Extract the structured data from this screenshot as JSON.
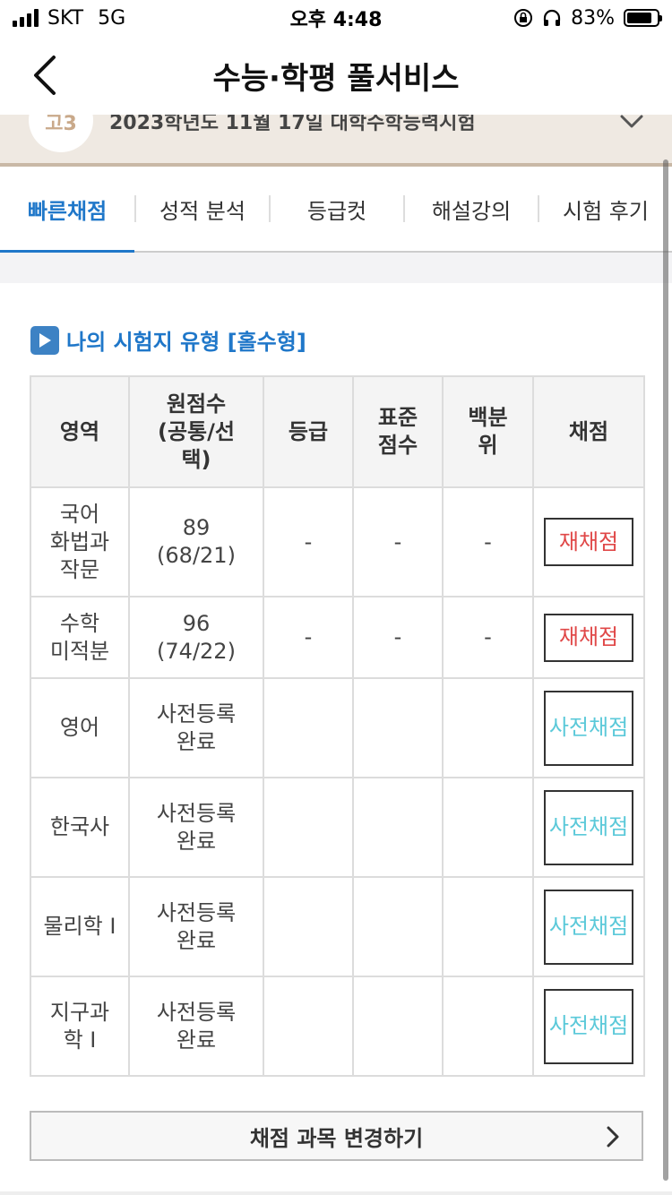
{
  "status_bar": {
    "carrier": "SKT",
    "network": "5G",
    "time": "오후 4:48",
    "battery_percent": "83%",
    "battery_level": 0.83
  },
  "nav": {
    "title": "수능·학평 풀서비스",
    "back_icon": "chevron-left-icon"
  },
  "exam": {
    "grade": "고3",
    "title": "2023학년도 11월 17일 대학수학능력시험"
  },
  "tabs": [
    {
      "label": "빠른채점",
      "active": true
    },
    {
      "label": "성적 분석",
      "active": false
    },
    {
      "label": "등급컷",
      "active": false
    },
    {
      "label": "해설강의",
      "active": false
    },
    {
      "label": "시험 후기",
      "active": false
    }
  ],
  "section": {
    "title": "나의 시험지 유형 [홀수형]"
  },
  "table": {
    "headers": {
      "area": "영역",
      "raw_line1": "원점수",
      "raw_line2": "(공통/선",
      "raw_line3": "택)",
      "grade": "등급",
      "std_line1": "표준",
      "std_line2": "점수",
      "pct_line1": "백분",
      "pct_line2": "위",
      "score": "채점"
    },
    "rows": [
      {
        "area1": "국어",
        "area2": "화법과",
        "area3": "작문",
        "raw1": "89",
        "raw2": "(68/21)",
        "grade": "-",
        "std": "-",
        "pct": "-",
        "btn1": "재채점",
        "btn2": ""
      },
      {
        "area1": "수학",
        "area2": "미적분",
        "area3": "",
        "raw1": "96",
        "raw2": "(74/22)",
        "grade": "-",
        "std": "-",
        "pct": "-",
        "btn1": "재채점",
        "btn2": ""
      },
      {
        "area1": "영어",
        "area2": "",
        "area3": "",
        "raw1": "사전등록",
        "raw2": "완료",
        "grade": "",
        "std": "",
        "pct": "",
        "btn1": "사전",
        "btn2": "채점"
      },
      {
        "area1": "한국사",
        "area2": "",
        "area3": "",
        "raw1": "사전등록",
        "raw2": "완료",
        "grade": "",
        "std": "",
        "pct": "",
        "btn1": "사전",
        "btn2": "채점"
      },
      {
        "area1": "물리학 I",
        "area2": "",
        "area3": "",
        "raw1": "사전등록",
        "raw2": "완료",
        "grade": "",
        "std": "",
        "pct": "",
        "btn1": "사전",
        "btn2": "채점"
      },
      {
        "area1": "지구과",
        "area2": "학 I",
        "area3": "",
        "raw1": "사전등록",
        "raw2": "완료",
        "grade": "",
        "std": "",
        "pct": "",
        "btn1": "사전",
        "btn2": "채점"
      }
    ]
  },
  "change_button": {
    "label": "채점 과목 변경하기"
  },
  "colors": {
    "accent": "#1f77c9",
    "rescore": "#e04848",
    "prescore": "#5bc9d9",
    "banner": "#efe9e2"
  }
}
